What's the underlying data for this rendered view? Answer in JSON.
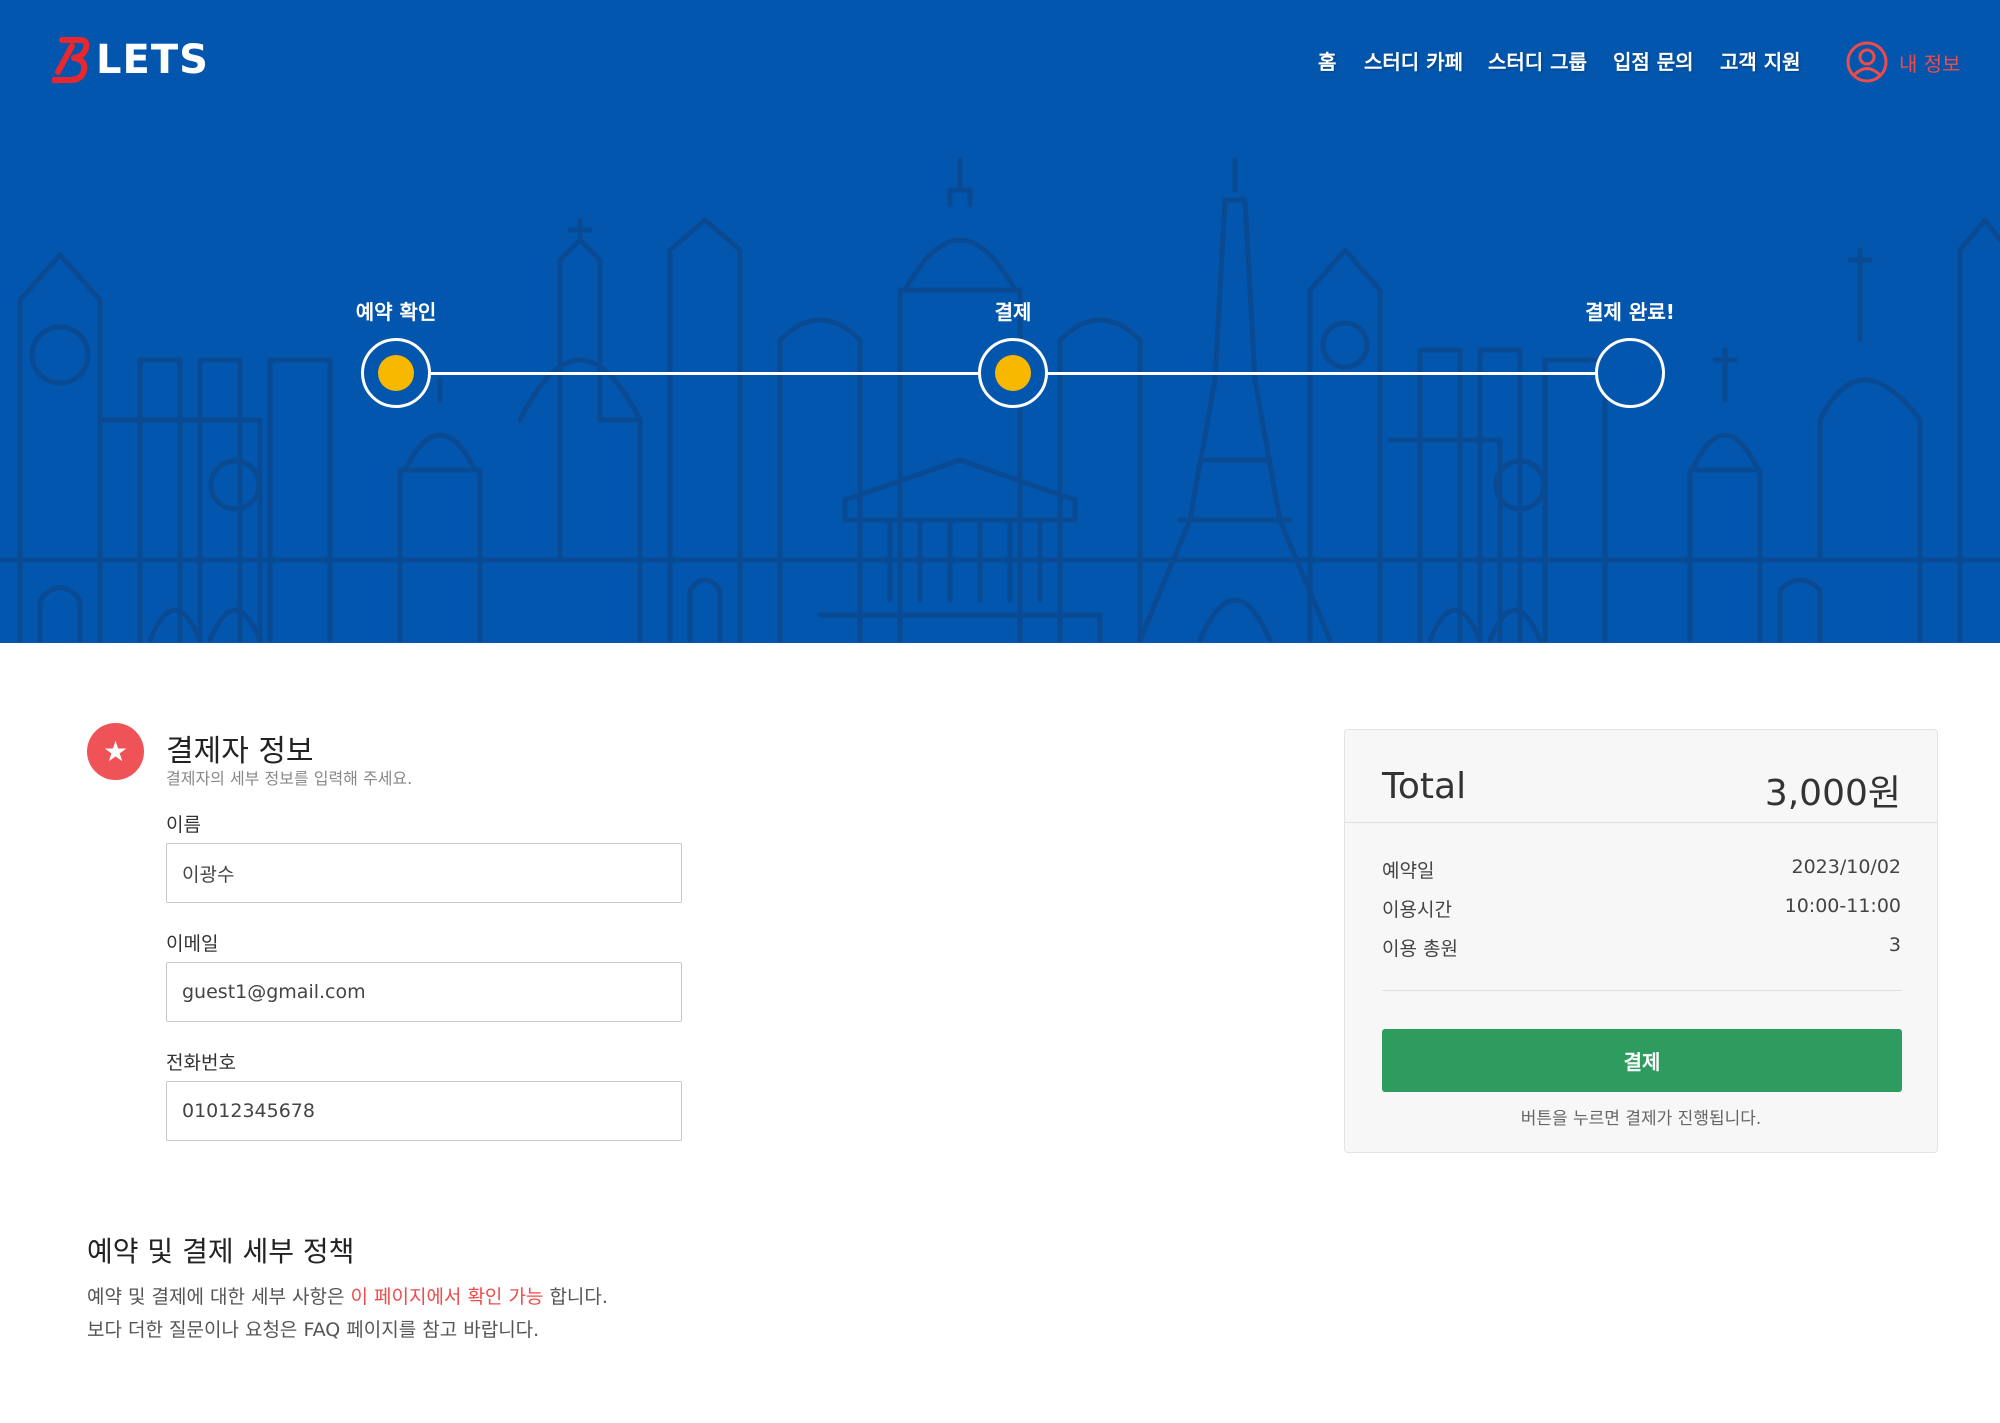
{
  "header": {
    "logo_text": "LETS",
    "nav": [
      {
        "label": "홈"
      },
      {
        "label": "스터디 카페"
      },
      {
        "label": "스터디 그룹"
      },
      {
        "label": "입점 문의"
      },
      {
        "label": "고객 지원"
      }
    ],
    "account_label": "내 정보",
    "account_icon": "user-circle-icon"
  },
  "stepper": {
    "steps": [
      {
        "label": "예약 확인",
        "completed": true
      },
      {
        "label": "결제",
        "completed": true
      },
      {
        "label": "결제 완료!",
        "completed": false
      }
    ]
  },
  "payer": {
    "badge_icon": "star-icon",
    "title": "결제자 정보",
    "subtitle": "결제자의 세부 정보를 입력해 주세요.",
    "fields": [
      {
        "label": "이름",
        "value": "이광수"
      },
      {
        "label": "이메일",
        "value": "guest1@gmail.com"
      },
      {
        "label": "전화번호",
        "value": "01012345678"
      }
    ]
  },
  "policy": {
    "title": "예약 및 결제 세부 정책",
    "line1_prefix": "예약 및 결제에 대한 세부 사항은 ",
    "line1_link": "이 페이지에서 확인 가능",
    "line1_suffix": " 합니다.",
    "line2": "보다 더한 질문이나 요청은 FAQ 페이지를 참고 바랍니다."
  },
  "summary": {
    "total_label": "Total",
    "total_value": "3,000원",
    "rows": [
      {
        "label": "예약일",
        "value": "2023/10/02"
      },
      {
        "label": "이용시간",
        "value": "10:00-11:00"
      },
      {
        "label": "이용 총원",
        "value": "3"
      }
    ],
    "pay_button_label": "결제",
    "note": "버튼을 누르면 결제가 진행됩니다."
  },
  "colors": {
    "hero_background": "#0356ad",
    "step_dot": "#f9b800",
    "accent_red": "#ef4b4b",
    "pay_button": "#2e9b5f"
  }
}
